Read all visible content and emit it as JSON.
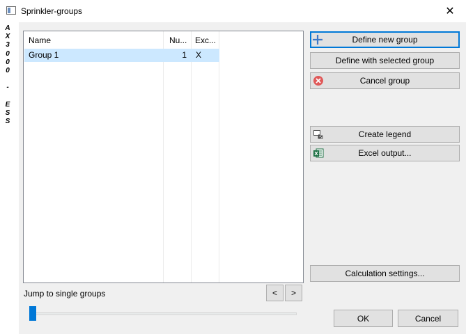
{
  "window": {
    "title": "Sprinkler-groups",
    "close_symbol": "✕"
  },
  "side_label": [
    "A",
    "X",
    "3",
    "0",
    "0",
    "0",
    "",
    "-",
    "",
    "E",
    "S",
    "S"
  ],
  "list": {
    "columns": [
      "Name",
      "Nu...",
      "Exc..."
    ],
    "rows": [
      {
        "name": "Group 1",
        "number": "1",
        "exclusive": "X"
      }
    ],
    "selected_row": 0
  },
  "buttons": {
    "define_new_group": "Define new group",
    "define_with_selected": "Define with selected group",
    "cancel_group": "Cancel group",
    "create_legend": "Create legend",
    "excel_output": "Excel output...",
    "calculation_settings": "Calculation settings...",
    "ok": "OK",
    "cancel": "Cancel",
    "prev": "<",
    "next": ">"
  },
  "jump": {
    "label": "Jump to single groups",
    "slider_position": 0
  },
  "colors": {
    "accent": "#0078d7",
    "selection": "#cce8ff",
    "cancel_icon": "#e05a5a",
    "excel_icon": "#1e7145"
  },
  "icons": {
    "define_new_group": "plus-icon",
    "cancel_group": "cancel-circle-icon",
    "create_legend": "legend-icon",
    "excel_output": "excel-icon"
  }
}
